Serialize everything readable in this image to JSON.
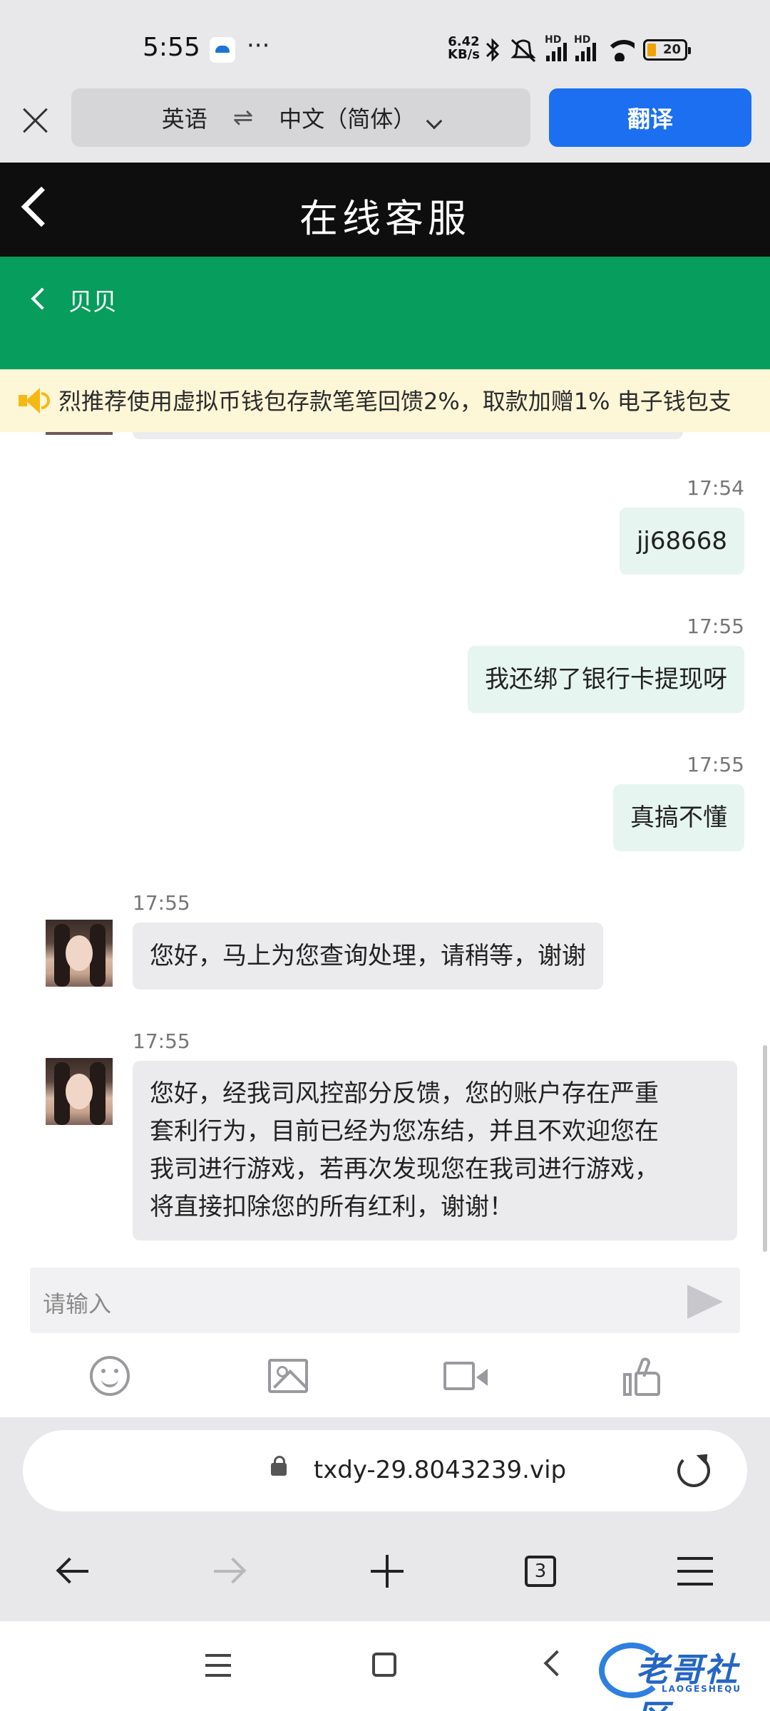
{
  "status_bar": {
    "time": "5:55",
    "more": "···",
    "net_speed_value": "6.42",
    "net_speed_unit": "KB/s",
    "sim1_label": "HD",
    "sim2_label": "HD",
    "battery": "20"
  },
  "translate_bar": {
    "source_lang": "英语",
    "swap_symbol": "⇌",
    "target_lang": "中文（简体）",
    "translate_button": "翻译"
  },
  "header": {
    "title": "在线客服"
  },
  "agent": {
    "name": "贝贝"
  },
  "notice": {
    "text": "烈推荐使用虚拟币钱包存款笔笔回馈2%，取款加赠1% 电子钱包支"
  },
  "messages": [
    {
      "side": "right",
      "time": "17:54",
      "text": "jj68668"
    },
    {
      "side": "right",
      "time": "17:55",
      "text": "我还绑了银行卡提现呀"
    },
    {
      "side": "right",
      "time": "17:55",
      "text": "真搞不懂"
    },
    {
      "side": "left",
      "time": "17:55",
      "text": "您好，马上为您查询处理，请稍等，谢谢"
    },
    {
      "side": "left",
      "time": "17:55",
      "lines": [
        "您好，经我司风控部分反馈，您的账户存在严重",
        "套利行为，目前已经为您冻结，并且不欢迎您在",
        "我司进行游戏，若再次发现您在我司进行游戏，",
        "将直接扣除您的所有红利，谢谢！"
      ]
    }
  ],
  "input": {
    "placeholder": "请输入"
  },
  "browser": {
    "url": "txdy-29.8043239.vip",
    "tab_count": "3"
  },
  "watermark": {
    "text": "老哥社区",
    "sub": "LAOGESHEQU"
  },
  "colors": {
    "brand_green": "#079d5c",
    "header_black": "#0e0e0e",
    "translate_blue": "#1b6ff0",
    "my_bubble": "#e6f5ef",
    "agent_bubble": "#ebebed",
    "notice_bg": "#fdf6d7"
  }
}
